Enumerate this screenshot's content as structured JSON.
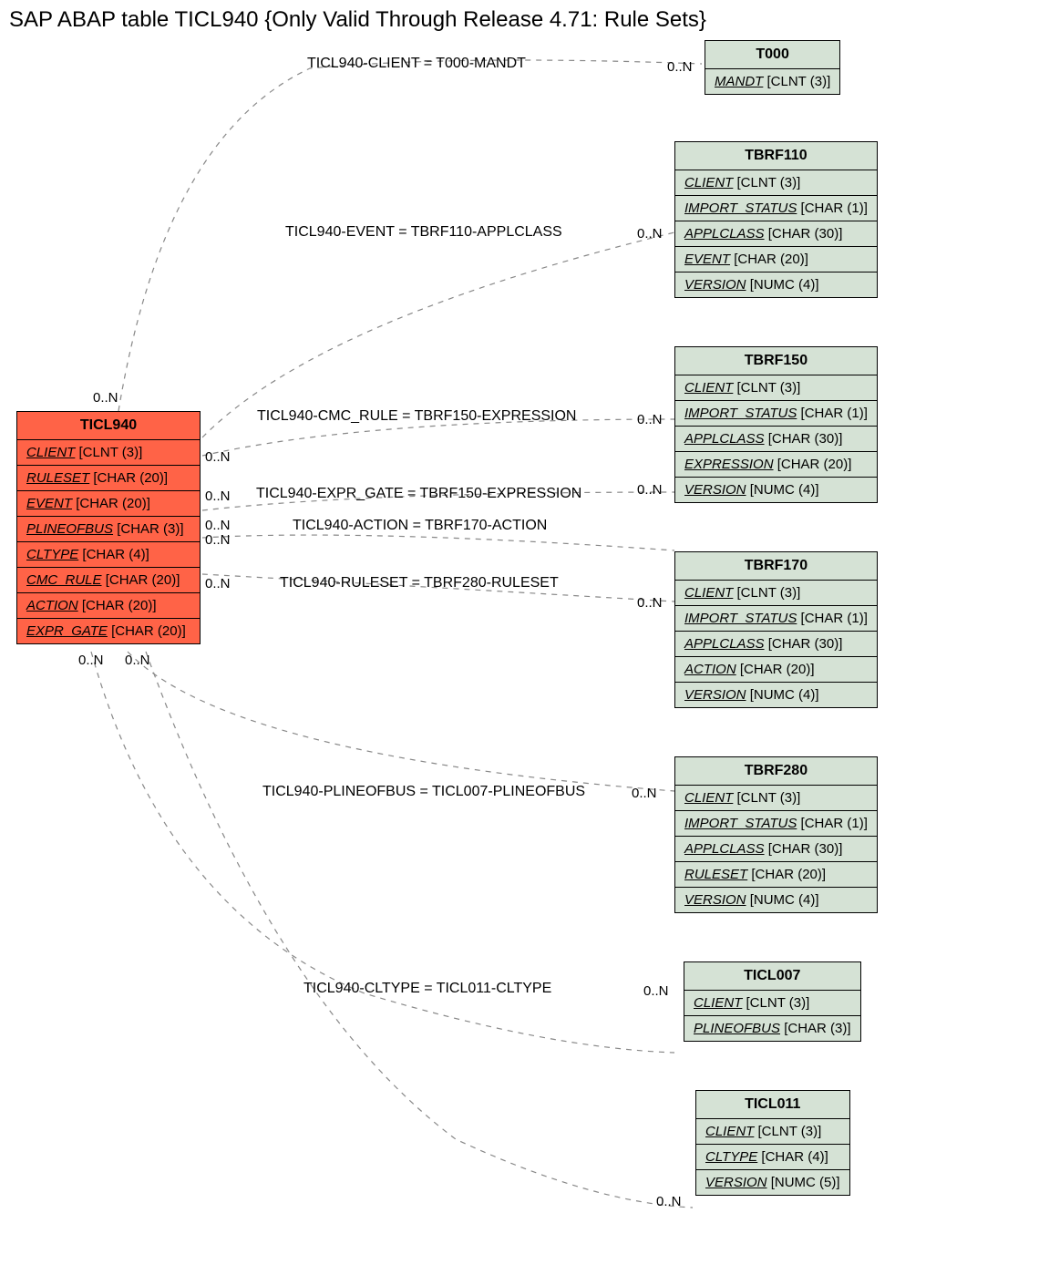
{
  "title": "SAP ABAP table TICL940 {Only Valid Through Release 4.71: Rule Sets}",
  "main_table": {
    "name": "TICL940",
    "fields": [
      {
        "name": "CLIENT",
        "type": "[CLNT (3)]"
      },
      {
        "name": "RULESET",
        "type": "[CHAR (20)]"
      },
      {
        "name": "EVENT",
        "type": "[CHAR (20)]"
      },
      {
        "name": "PLINEOFBUS",
        "type": "[CHAR (3)]"
      },
      {
        "name": "CLTYPE",
        "type": "[CHAR (4)]"
      },
      {
        "name": "CMC_RULE",
        "type": "[CHAR (20)]"
      },
      {
        "name": "ACTION",
        "type": "[CHAR (20)]"
      },
      {
        "name": "EXPR_GATE",
        "type": "[CHAR (20)]"
      }
    ]
  },
  "related_tables": [
    {
      "name": "T000",
      "fields": [
        {
          "name": "MANDT",
          "type": "[CLNT (3)]"
        }
      ]
    },
    {
      "name": "TBRF110",
      "fields": [
        {
          "name": "CLIENT",
          "type": "[CLNT (3)]"
        },
        {
          "name": "IMPORT_STATUS",
          "type": "[CHAR (1)]"
        },
        {
          "name": "APPLCLASS",
          "type": "[CHAR (30)]"
        },
        {
          "name": "EVENT",
          "type": "[CHAR (20)]"
        },
        {
          "name": "VERSION",
          "type": "[NUMC (4)]"
        }
      ]
    },
    {
      "name": "TBRF150",
      "fields": [
        {
          "name": "CLIENT",
          "type": "[CLNT (3)]"
        },
        {
          "name": "IMPORT_STATUS",
          "type": "[CHAR (1)]"
        },
        {
          "name": "APPLCLASS",
          "type": "[CHAR (30)]"
        },
        {
          "name": "EXPRESSION",
          "type": "[CHAR (20)]"
        },
        {
          "name": "VERSION",
          "type": "[NUMC (4)]"
        }
      ]
    },
    {
      "name": "TBRF170",
      "fields": [
        {
          "name": "CLIENT",
          "type": "[CLNT (3)]"
        },
        {
          "name": "IMPORT_STATUS",
          "type": "[CHAR (1)]"
        },
        {
          "name": "APPLCLASS",
          "type": "[CHAR (30)]"
        },
        {
          "name": "ACTION",
          "type": "[CHAR (20)]"
        },
        {
          "name": "VERSION",
          "type": "[NUMC (4)]"
        }
      ]
    },
    {
      "name": "TBRF280",
      "fields": [
        {
          "name": "CLIENT",
          "type": "[CLNT (3)]"
        },
        {
          "name": "IMPORT_STATUS",
          "type": "[CHAR (1)]"
        },
        {
          "name": "APPLCLASS",
          "type": "[CHAR (30)]"
        },
        {
          "name": "RULESET",
          "type": "[CHAR (20)]"
        },
        {
          "name": "VERSION",
          "type": "[NUMC (4)]"
        }
      ]
    },
    {
      "name": "TICL007",
      "fields": [
        {
          "name": "CLIENT",
          "type": "[CLNT (3)]"
        },
        {
          "name": "PLINEOFBUS",
          "type": "[CHAR (3)]"
        }
      ]
    },
    {
      "name": "TICL011",
      "fields": [
        {
          "name": "CLIENT",
          "type": "[CLNT (3)]"
        },
        {
          "name": "CLTYPE",
          "type": "[CHAR (4)]"
        },
        {
          "name": "VERSION",
          "type": "[NUMC (5)]"
        }
      ]
    }
  ],
  "edges": [
    {
      "label": "TICL940-CLIENT = T000-MANDT"
    },
    {
      "label": "TICL940-EVENT = TBRF110-APPLCLASS"
    },
    {
      "label": "TICL940-CMC_RULE = TBRF150-EXPRESSION"
    },
    {
      "label": "TICL940-EXPR_GATE = TBRF150-EXPRESSION"
    },
    {
      "label": "TICL940-ACTION = TBRF170-ACTION"
    },
    {
      "label": "TICL940-RULESET = TBRF280-RULESET"
    },
    {
      "label": "TICL940-PLINEOFBUS = TICL007-PLINEOFBUS"
    },
    {
      "label": "TICL940-CLTYPE = TICL011-CLTYPE"
    }
  ],
  "cardinality": "0..N"
}
